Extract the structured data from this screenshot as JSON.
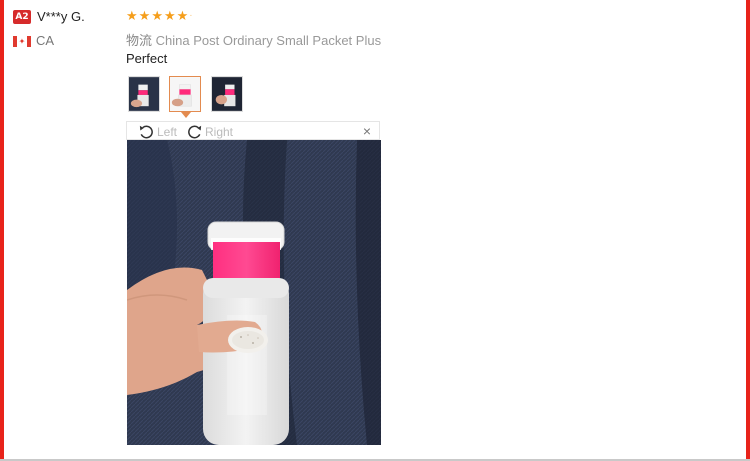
{
  "review": {
    "user_badge": "A2",
    "user_name": "V***y G.",
    "country": "CA",
    "rating": 5,
    "shipping_label": "物流",
    "shipping_method": "China Post Ordinary Small Packet Plus",
    "text": "Perfect"
  },
  "viewer": {
    "rotate_left_label": "Left",
    "rotate_right_label": "Right",
    "close_icon": "×",
    "thumbnails_count": 3,
    "selected_thumbnail": 2
  },
  "colors": {
    "frame": "#e8231a",
    "star": "#f59e1b",
    "badge": "#d62b2b",
    "thumb_active_border": "#e38b4f",
    "product_pink": "#ff1f73"
  },
  "icons": {
    "star": "star-icon",
    "rotate_left": "rotate-left-icon",
    "rotate_right": "rotate-right-icon",
    "close": "close-icon",
    "flag": "canada-flag-icon"
  }
}
